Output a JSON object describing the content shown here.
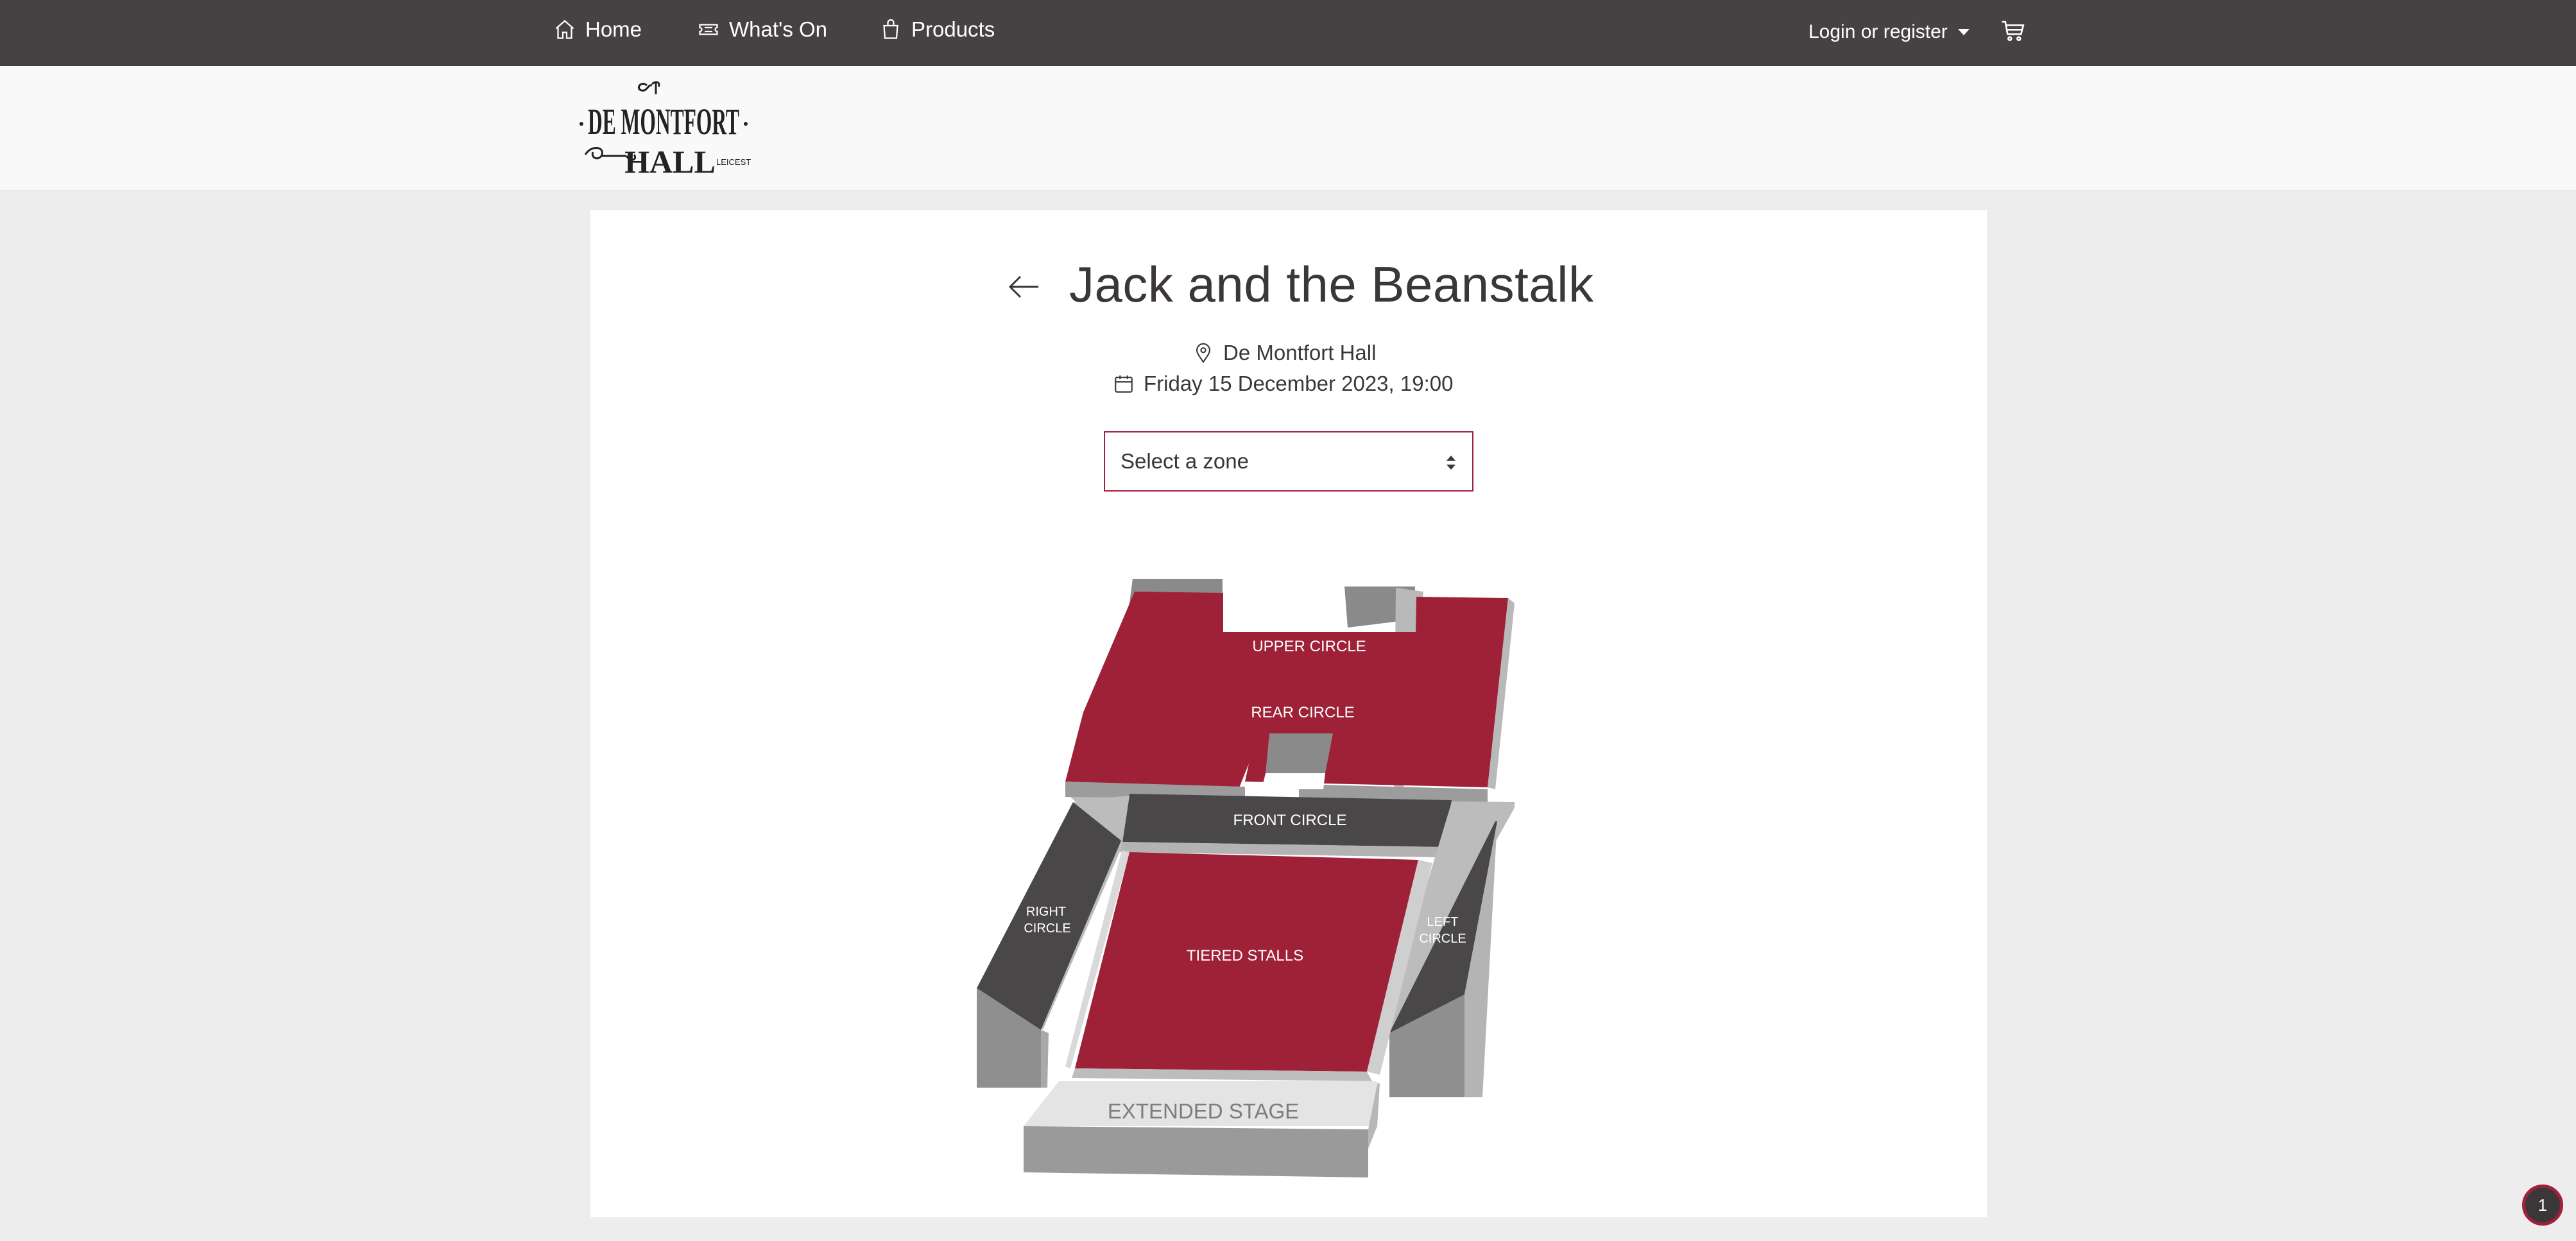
{
  "nav": {
    "home": "Home",
    "whats_on": "What's On",
    "products": "Products",
    "login": "Login or register"
  },
  "logo": {
    "line1": "DE MONTFORT",
    "line2": "HALL",
    "city": "LEICESTER"
  },
  "event": {
    "title": "Jack and the Beanstalk",
    "venue": "De Montfort Hall",
    "datetime": "Friday 15 December 2023, 19:00"
  },
  "zone_select": {
    "value": "Select a zone"
  },
  "seatmap": {
    "zones": {
      "upper_circle": "UPPER CIRCLE",
      "rear_circle": "REAR CIRCLE",
      "front_circle": "FRONT CIRCLE",
      "right_circle_1": "RIGHT",
      "right_circle_2": "CIRCLE",
      "left_circle_1": "LEFT",
      "left_circle_2": "CIRCLE",
      "tiered_stalls": "TIERED STALLS",
      "extended_stage": "EXTENDED STAGE"
    }
  },
  "notification": {
    "count": "1"
  },
  "colors": {
    "nav_bg": "#464143",
    "accent": "#a0203c",
    "zone_red": "#9e2138",
    "zone_dark": "#4a4748",
    "page_bg": "#ededed"
  }
}
